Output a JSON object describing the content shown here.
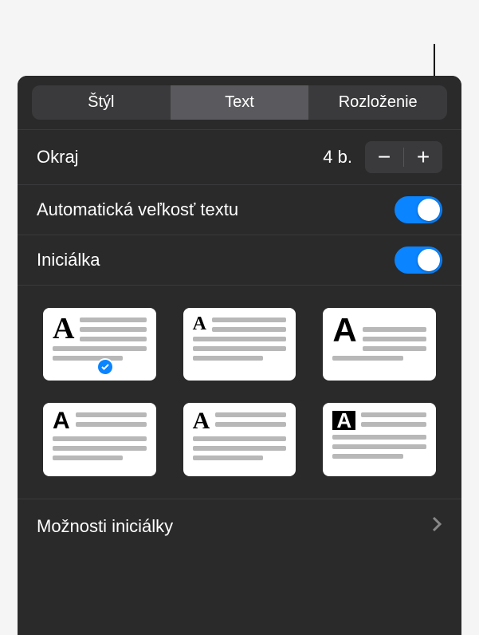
{
  "tabs": {
    "style": "Štýl",
    "text": "Text",
    "layout": "Rozloženie"
  },
  "margin": {
    "label": "Okraj",
    "value": "4 b."
  },
  "autoTextSize": {
    "label": "Automatická veľkosť textu",
    "enabled": true
  },
  "dropCap": {
    "label": "Iniciálka",
    "enabled": true
  },
  "dropCapStyles": {
    "selectedIndex": 0,
    "count": 6
  },
  "optionsLabel": "Možnosti iniciálky",
  "colors": {
    "accent": "#0a84ff",
    "panelBg": "#2a2a2a"
  }
}
